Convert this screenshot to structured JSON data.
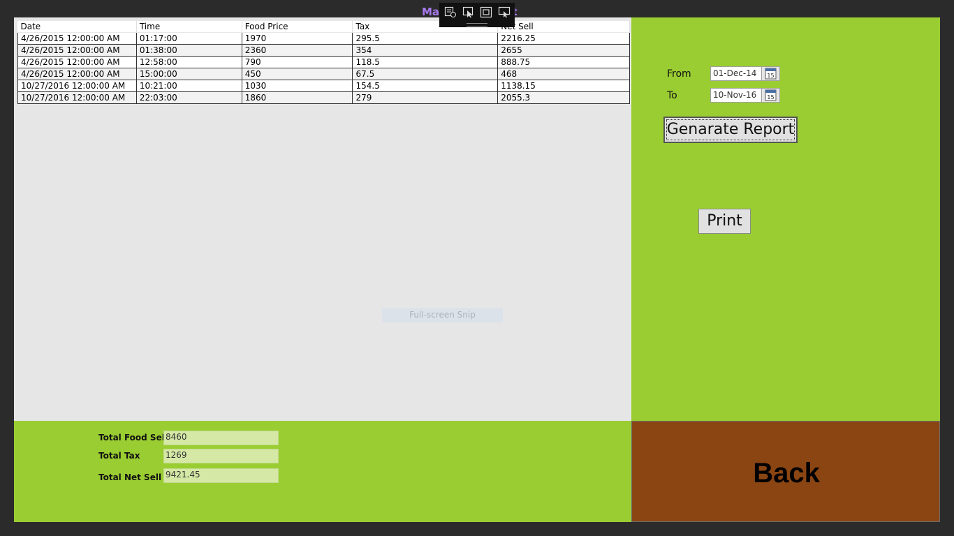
{
  "window": {
    "title": "Manager Report"
  },
  "grid": {
    "columns": [
      "Date",
      "Time",
      "Food Price",
      "Tax",
      "Net Sell"
    ],
    "rows": [
      [
        "4/26/2015 12:00:00 AM",
        "01:17:00",
        "1970",
        "295.5",
        "2216.25"
      ],
      [
        "4/26/2015 12:00:00 AM",
        "01:38:00",
        "2360",
        "354",
        "2655"
      ],
      [
        "4/26/2015 12:00:00 AM",
        "12:58:00",
        "790",
        "118.5",
        "888.75"
      ],
      [
        "4/26/2015 12:00:00 AM",
        "15:00:00",
        "450",
        "67.5",
        "468"
      ],
      [
        "10/27/2016 12:00:00 AM",
        "10:21:00",
        "1030",
        "154.5",
        "1138.15"
      ],
      [
        "10/27/2016 12:00:00 AM",
        "22:03:00",
        "1860",
        "279",
        "2055.3"
      ]
    ]
  },
  "overlay": {
    "snip_label": "Full-screen Snip"
  },
  "filters": {
    "from_label": "From",
    "from_value": "01-Dec-14",
    "to_label": "To",
    "to_value": "10-Nov-16",
    "calendar_icon_text": "15"
  },
  "buttons": {
    "generate": "Genarate Report",
    "print": "Print",
    "back": "Back"
  },
  "totals": {
    "food_sell_label": "Total Food Sell",
    "food_sell_value": "8460",
    "tax_label": "Total Tax",
    "tax_value": "1269",
    "net_sell_label": "Total Net Sell",
    "net_sell_value": "9421.45"
  },
  "colors": {
    "panel_green": "#9acd32",
    "back_brown": "#8b4513",
    "title_purple": "#a879f0"
  }
}
